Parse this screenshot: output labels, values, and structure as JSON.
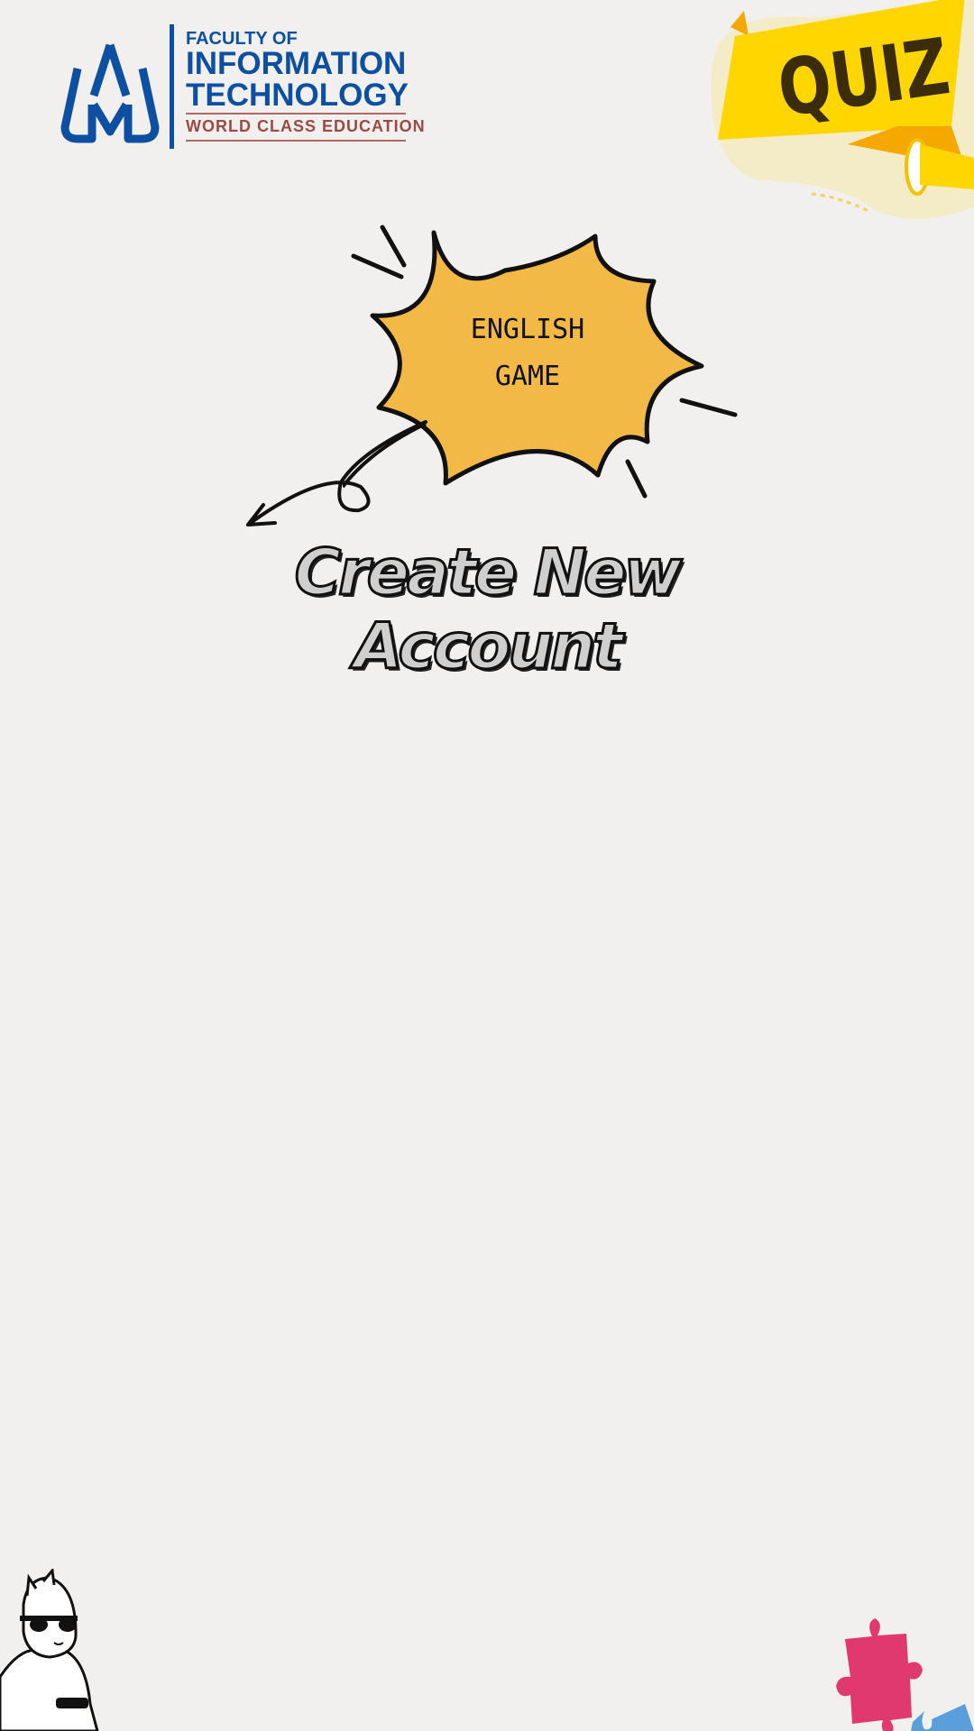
{
  "logo": {
    "line1": "FACULTY OF",
    "line2": "INFORMATION",
    "line3": "TECHNOLOGY",
    "tagline": "WORLD CLASS EDUCATION",
    "brand_color": "#0d4fa0"
  },
  "quiz_badge": {
    "label": "QUIZ",
    "color": "#ffd600"
  },
  "burst": {
    "line1": "ENGLISH",
    "line2": "GAME",
    "color": "#f2b946"
  },
  "title": "Create New Account"
}
